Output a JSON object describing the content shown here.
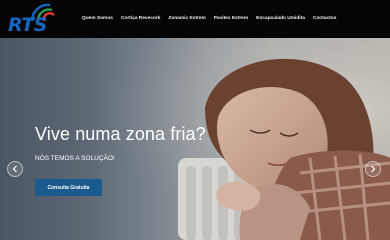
{
  "brand": {
    "logo_text": "RTS",
    "colors": {
      "primary": "#1565c0",
      "arc": [
        "#1565c0",
        "#2e9e4a",
        "#e53935"
      ]
    }
  },
  "nav": {
    "items": [
      {
        "label": "Quem Somos"
      },
      {
        "label": "Cortiça Revecork"
      },
      {
        "label": "Zonamic Extrem"
      },
      {
        "label": "Pavitex Extrem"
      },
      {
        "label": "Encapsulado Umidita"
      },
      {
        "label": "Contactos"
      }
    ]
  },
  "hero": {
    "headline": "Vive numa zona fria?",
    "subline": "NÓS TEMOS A SOLUÇÃO!",
    "cta_label": "Consulta Gratuita",
    "cta_color": "#1b5a8e",
    "prev_icon": "chevron-left-icon",
    "next_icon": "chevron-right-icon"
  }
}
